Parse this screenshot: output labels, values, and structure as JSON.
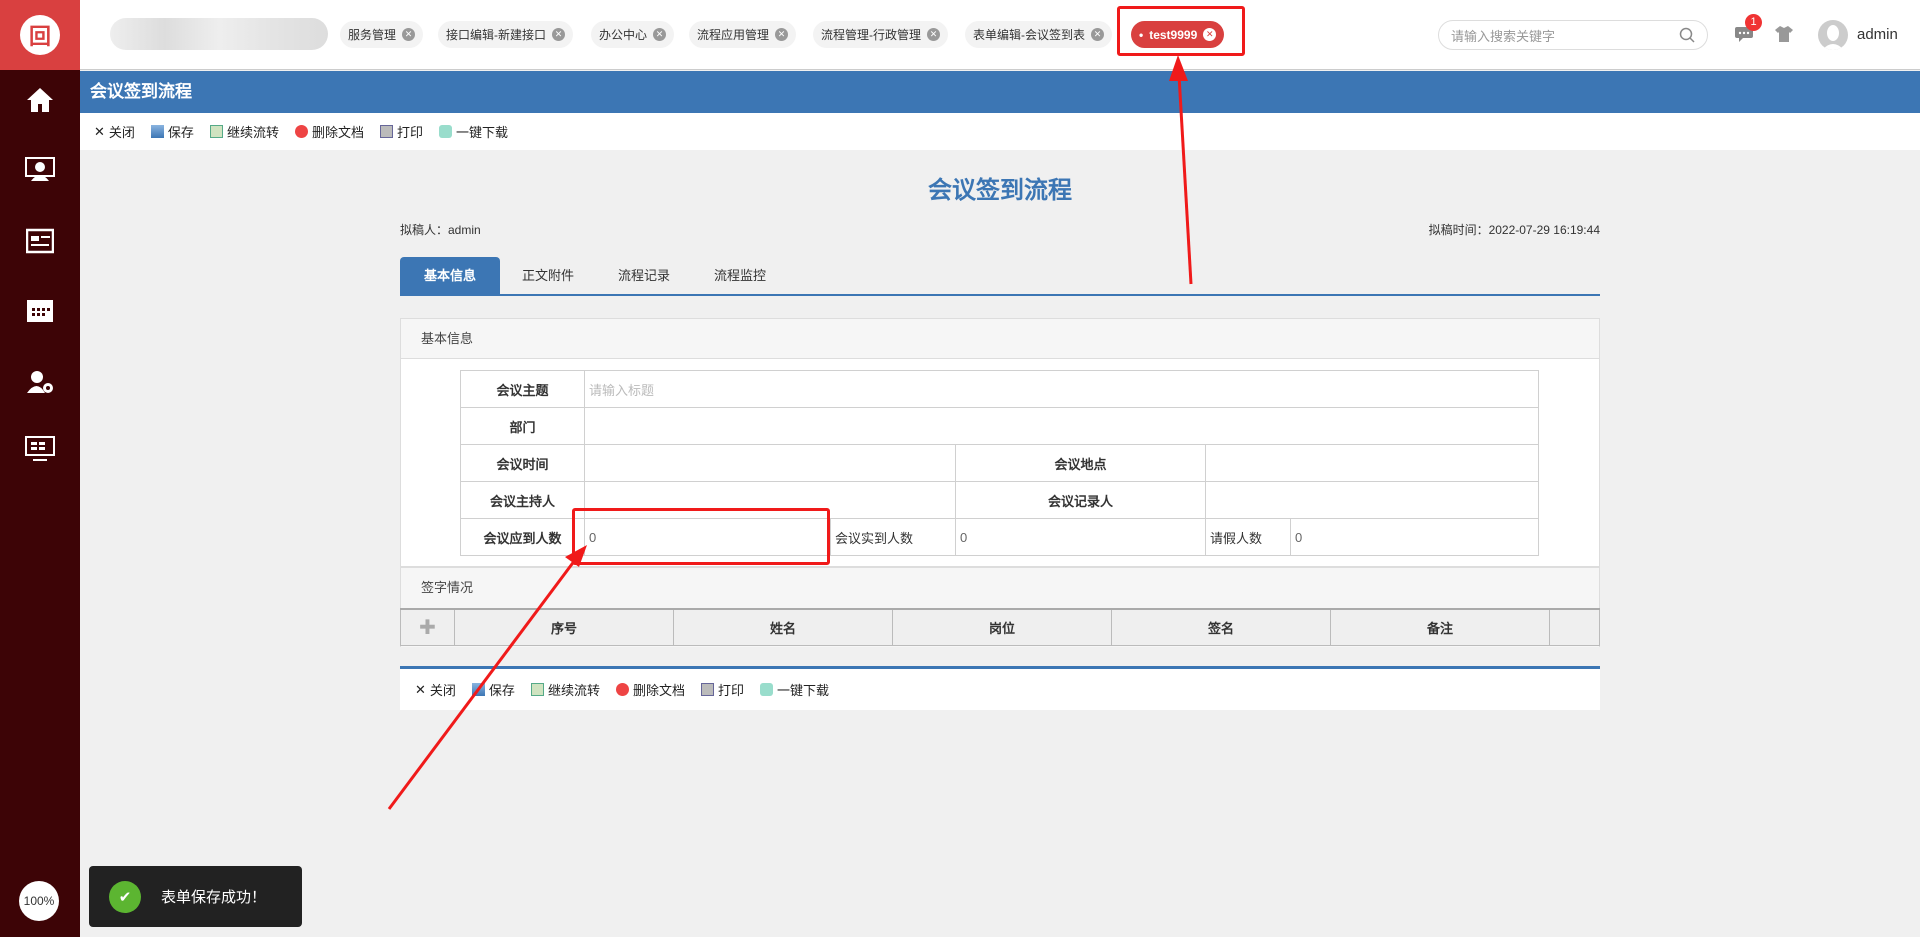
{
  "sidebar": {
    "logo": "回",
    "items": [
      "home",
      "meeting",
      "news",
      "calendar",
      "user-settings",
      "monitor"
    ],
    "zoom": "100%"
  },
  "tabs": [
    "服务管理",
    "接口编辑-新建接口",
    "办公中心",
    "流程应用管理",
    "流程管理-行政管理",
    "表单编辑-会议签到表",
    "test9999"
  ],
  "header": {
    "search_placeholder": "请输入搜索关键字",
    "badge": "1",
    "user": "admin"
  },
  "title_bar": "会议签到流程",
  "toolbar": {
    "close": "关闭",
    "save": "保存",
    "continue": "继续流转",
    "delete": "删除文档",
    "print": "打印",
    "download": "一键下载"
  },
  "doc": {
    "title": "会议签到流程",
    "drafter": "拟稿人：admin",
    "draft_time": "拟稿时间：2022-07-29 16:19:44"
  },
  "form_tabs": [
    "基本信息",
    "正文附件",
    "流程记录",
    "流程监控"
  ],
  "basic": {
    "heading": "基本信息",
    "subject_label": "会议主题",
    "subject_placeholder": "请输入标题",
    "dept_label": "部门",
    "time_label": "会议时间",
    "place_label": "会议地点",
    "host_label": "会议主持人",
    "recorder_label": "会议记录人",
    "expected_label": "会议应到人数",
    "expected": "0",
    "actual_label": "会议实到人数",
    "actual": "0",
    "leave_label": "请假人数",
    "leave": "0"
  },
  "sign": {
    "heading": "签字情况",
    "columns": [
      "序号",
      "姓名",
      "岗位",
      "签名",
      "备注"
    ]
  },
  "toast": "表单保存成功！",
  "colors": {
    "primary": "#3c76b4",
    "sidebar": "#3d0406",
    "accent": "#d9403f"
  }
}
